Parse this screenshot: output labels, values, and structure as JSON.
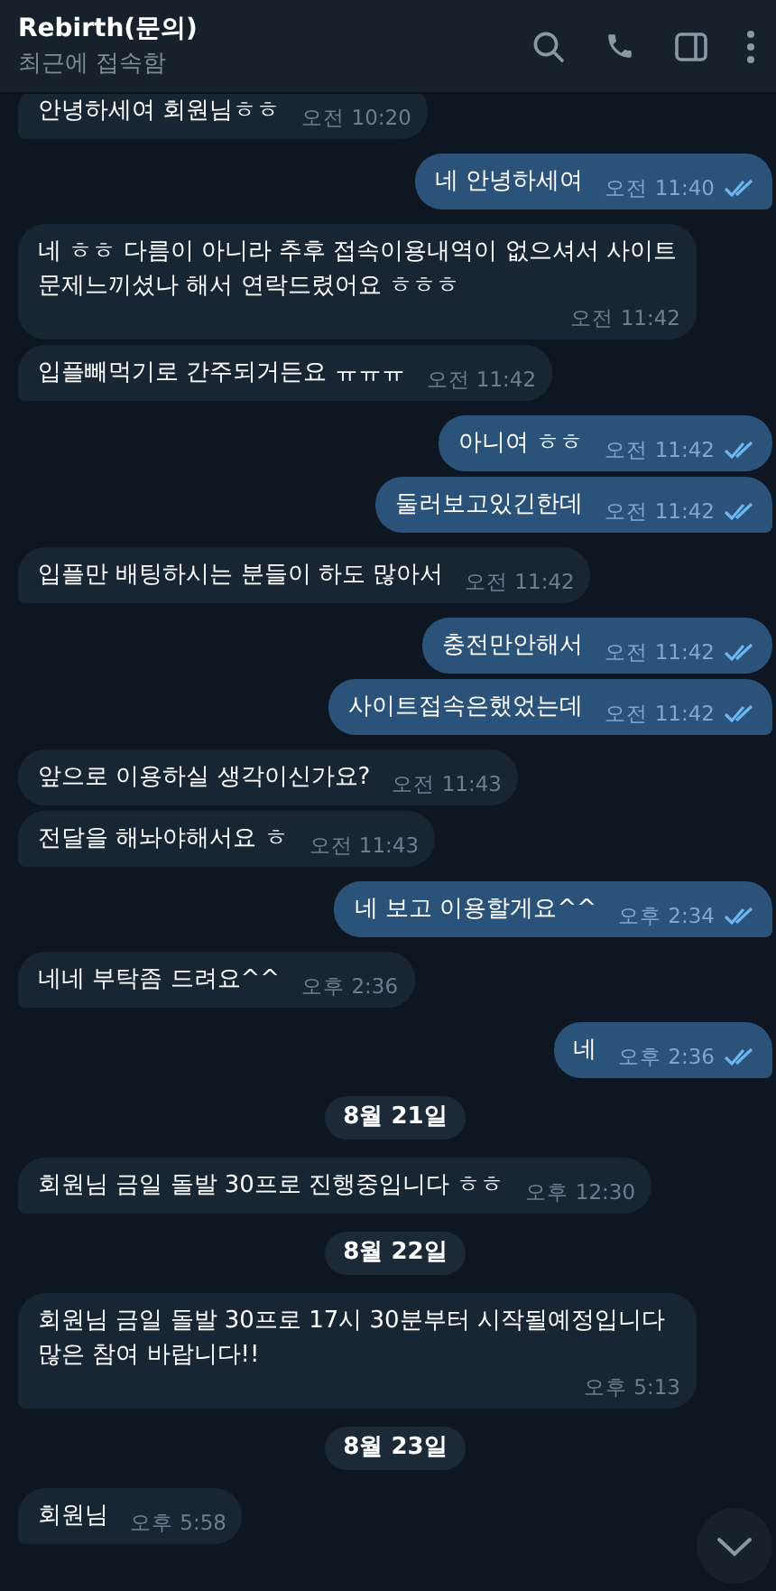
{
  "header": {
    "title": "Rebirth(문의)",
    "status": "최근에 접속함"
  },
  "messages": [
    {
      "kind": "in",
      "text": "안녕하세여 회원님ㅎㅎ",
      "time": "오전 10:20"
    },
    {
      "kind": "out",
      "text": "네 안녕하세여",
      "time": "오전 11:40",
      "read": true
    },
    {
      "kind": "in",
      "text": "네 ㅎㅎ 다름이 아니라 추후 접속이용내역이 없으셔서 사이트 문제느끼셨나 해서 연락드렸어요 ㅎㅎㅎ",
      "time": "오전 11:42"
    },
    {
      "kind": "in",
      "text": "입플빼먹기로 간주되거든요 ㅠㅠㅠ",
      "time": "오전 11:42"
    },
    {
      "kind": "out",
      "text": "아니여 ㅎㅎ",
      "time": "오전 11:42",
      "read": true
    },
    {
      "kind": "out",
      "text": "둘러보고있긴한데",
      "time": "오전 11:42",
      "read": true
    },
    {
      "kind": "in",
      "text": "입플만 배팅하시는 분들이 하도 많아서",
      "time": "오전 11:42"
    },
    {
      "kind": "out",
      "text": "충전만안해서",
      "time": "오전 11:42",
      "read": true
    },
    {
      "kind": "out",
      "text": "사이트접속은했었는데",
      "time": "오전 11:42",
      "read": true
    },
    {
      "kind": "in",
      "text": "앞으로 이용하실 생각이신가요?",
      "time": "오전 11:43"
    },
    {
      "kind": "in",
      "text": "전달을 해놔야해서요 ㅎ",
      "time": "오전 11:43"
    },
    {
      "kind": "out",
      "text": "네 보고 이용할게요^^",
      "time": "오후 2:34",
      "read": true
    },
    {
      "kind": "in",
      "text": "네네 부탁좀 드려요^^",
      "time": "오후 2:36"
    },
    {
      "kind": "out",
      "text": "네",
      "time": "오후 2:36",
      "read": true
    },
    {
      "kind": "date",
      "text": "8월 21일"
    },
    {
      "kind": "in",
      "text": "회원님 금일 돌발 30프로 진행중입니다 ㅎㅎ",
      "time": "오후 12:30"
    },
    {
      "kind": "date",
      "text": "8월 22일"
    },
    {
      "kind": "in",
      "text": "회원님 금일 돌발 30프로 17시 30분부터 시작될예정입니다 많은 참여 바랍니다!!",
      "time": "오후 5:13"
    },
    {
      "kind": "date",
      "text": "8월 23일"
    },
    {
      "kind": "in",
      "text": "회원님",
      "time": "오후 5:58"
    }
  ]
}
